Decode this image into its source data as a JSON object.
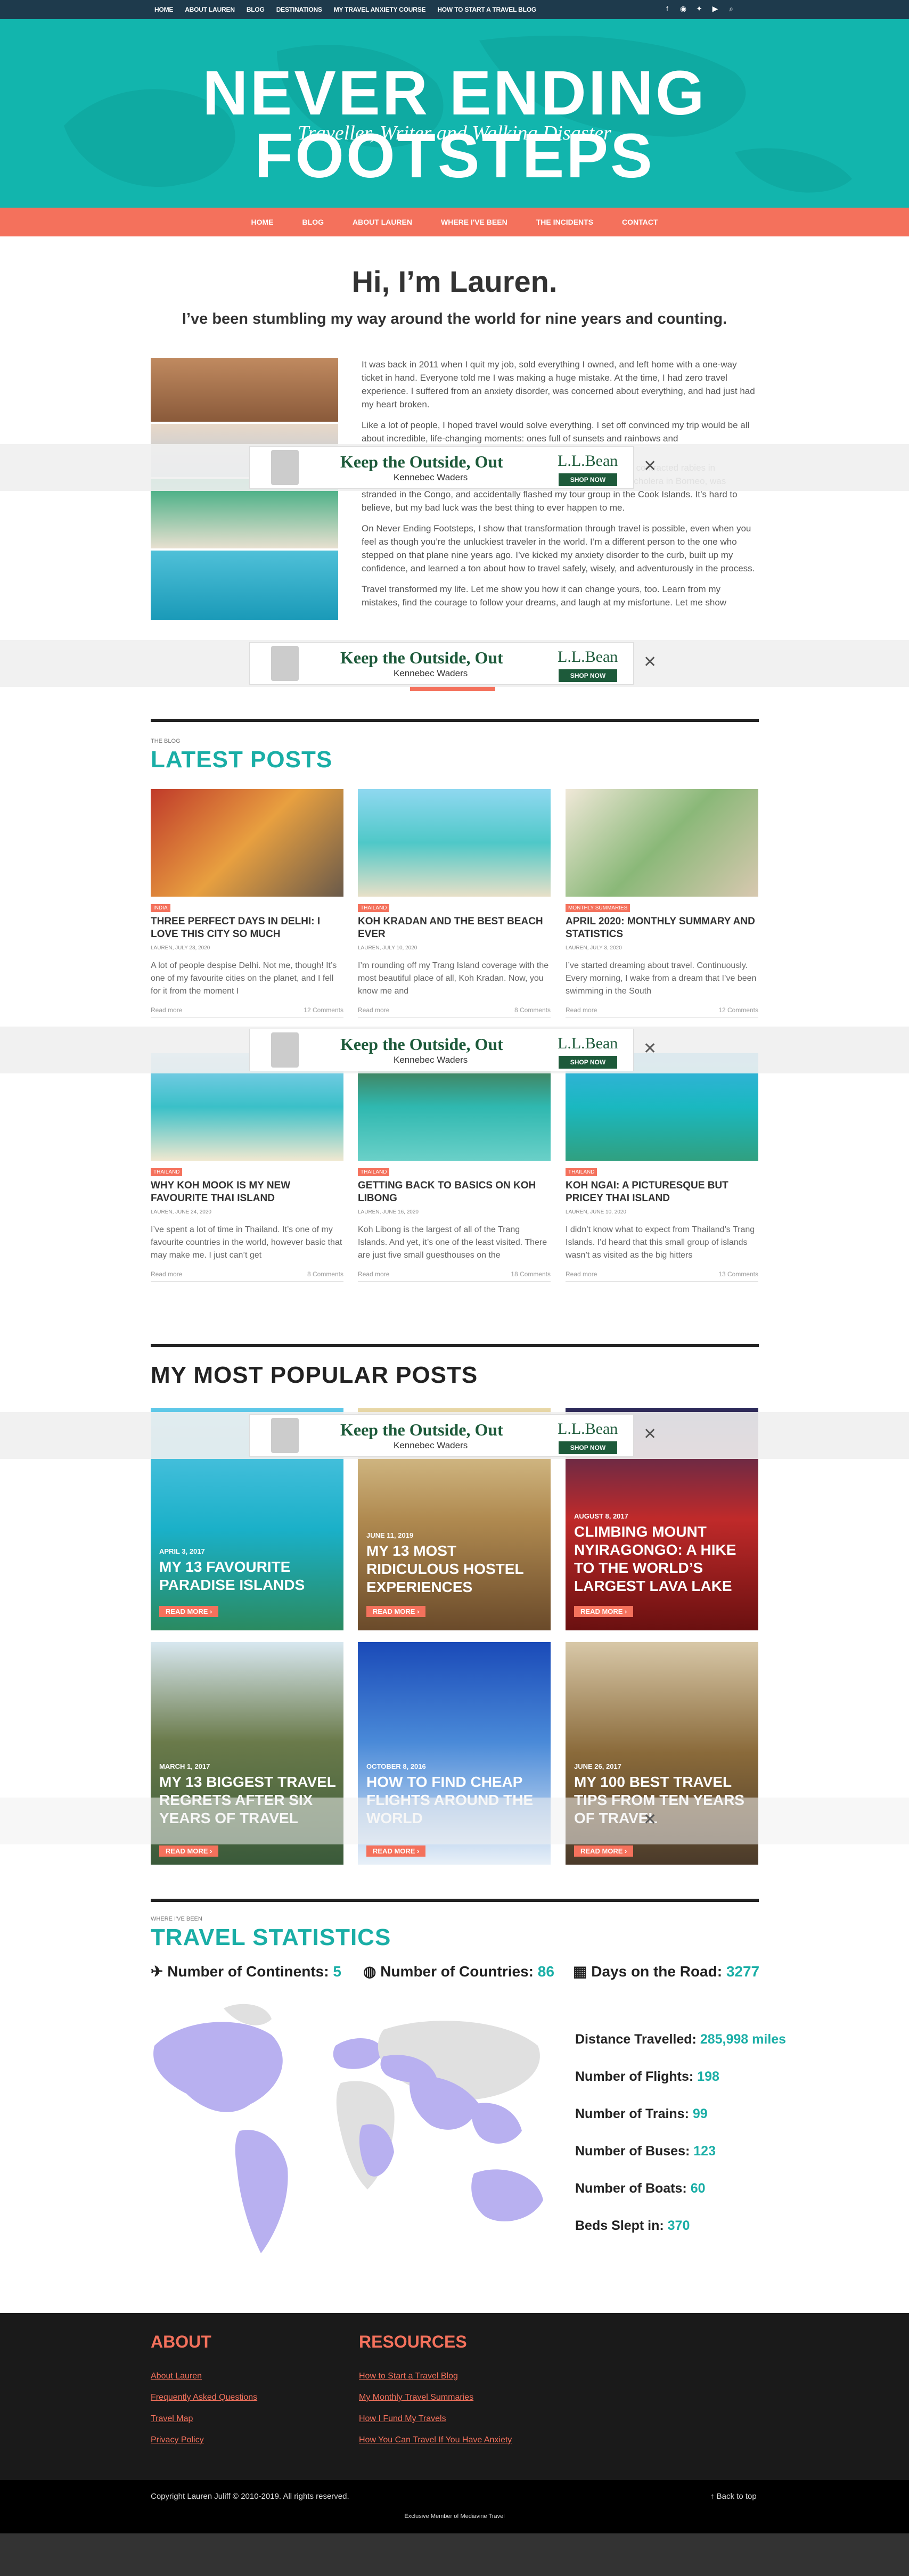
{
  "topbar": {
    "links": [
      "HOME",
      "ABOUT LAUREN",
      "BLOG",
      "DESTINATIONS",
      "MY TRAVEL ANXIETY COURSE",
      "HOW TO START A TRAVEL BLOG"
    ],
    "icons": [
      "facebook-icon",
      "rss-icon",
      "twitter-icon",
      "youtube-icon",
      "search-icon"
    ]
  },
  "hero": {
    "title": "NEVER ENDING FOOTSTEPS",
    "tagline": "Traveller, Writer and Walking Disaster"
  },
  "nav": [
    "HOME",
    "BLOG",
    "ABOUT LAUREN",
    "WHERE I'VE BEEN",
    "THE INCIDENTS",
    "CONTACT"
  ],
  "intro": {
    "heading": "Hi, I’m Lauren.",
    "subheading": "I’ve been stumbling my way around the world for nine years and counting.",
    "paragraphs": [
      "It was back in 2011 when I quit my job, sold everything I owned, and left home with a one-way ticket in hand. Everyone told me I was making a huge mistake. At the time, I had zero travel experience. I suffered from an anxiety disorder, was concerned about everything, and had just had my heart broken.",
      "Like a lot of people, I hoped travel would solve everything. I set off convinced my trip would be all about incredible, life-changing moments: ones full of sunsets and rainbows and",
      "was pickpocketed in Barcelona, run over by a motorbike in Vietnam, contracted rabies in Indonesia, and accidentally eaten a cockroach in Laos. I contracted cholera in Borneo, was stranded in the Congo, and accidentally flashed my tour group in the Cook Islands. It’s hard to believe, but my bad luck was the best thing to ever happen to me.",
      "On Never Ending Footsteps, I show that transformation through travel is possible, even when you feel as though you’re the unluckiest traveler in the world. I’m a different person to the one who stepped on that plane nine years ago. I’ve kicked my anxiety disorder to the curb, built up my confidence, and learned a ton about how to travel safely, wisely, and adventurously in the process.",
      "Travel transformed my life. Let me show you how it can change yours, too. Learn from my mistakes, find the courage to follow your dreams, and laugh at my misfortune. Let me show"
    ]
  },
  "ad": {
    "headline": "Keep the Outside, Out",
    "subline": "Kennebec Waders",
    "brand": "L.L.Bean",
    "cta": "SHOP NOW",
    "close": "✕"
  },
  "latest": {
    "eyebrow": "THE BLOG",
    "heading": "LATEST POSTS",
    "posts": [
      {
        "cat": "INDIA",
        "title": "THREE PERFECT DAYS IN DELHI: I LOVE THIS CITY SO MUCH",
        "meta": "LAUREN, JULY 23, 2020",
        "excerpt": "A lot of people despise Delhi. Not me, though! It’s one of my favourite cities on the planet, and I fell for it from the moment I",
        "more": "Read more",
        "comments": "12 Comments"
      },
      {
        "cat": "THAILAND",
        "title": "KOH KRADAN AND THE BEST BEACH EVER",
        "meta": "LAUREN, JULY 10, 2020",
        "excerpt": "I’m rounding off my Trang Island coverage with the most beautiful place of all, Koh Kradan. Now, you know me and",
        "more": "Read more",
        "comments": "8 Comments"
      },
      {
        "cat": "MONTHLY SUMMARIES",
        "title": "APRIL 2020: MONTHLY SUMMARY AND STATISTICS",
        "meta": "LAUREN, JULY 3, 2020",
        "excerpt": "I’ve started dreaming about travel. Continuously. Every morning, I wake from a dream that I’ve been swimming in the South",
        "more": "Read more",
        "comments": "12 Comments"
      },
      {
        "cat": "THAILAND",
        "title": "WHY KOH MOOK IS MY NEW FAVOURITE THAI ISLAND",
        "meta": "LAUREN, JUNE 24, 2020",
        "excerpt": "I’ve spent a lot of time in Thailand. It’s one of my favourite countries in the world, however basic that may make me. I just can’t get",
        "more": "Read more",
        "comments": "8 Comments"
      },
      {
        "cat": "THAILAND",
        "title": "GETTING BACK TO BASICS ON KOH LIBONG",
        "meta": "LAUREN, JUNE 16, 2020",
        "excerpt": "Koh Libong is the largest of all of the Trang Islands. And yet, it’s one of the least visited. There are just five small guesthouses on the",
        "more": "Read more",
        "comments": "18 Comments"
      },
      {
        "cat": "THAILAND",
        "title": "KOH NGAI: A PICTURESQUE BUT PRICEY THAI ISLAND",
        "meta": "LAUREN, JUNE 10, 2020",
        "excerpt": "I didn’t know what to expect from Thailand’s Trang Islands. I’d heard that this small group of islands wasn’t as visited as the big hitters",
        "more": "Read more",
        "comments": "13 Comments"
      }
    ]
  },
  "popular": {
    "heading": "MY MOST POPULAR POSTS",
    "more": "READ MORE",
    "posts": [
      {
        "date": "APRIL 3, 2017",
        "title": "MY 13 FAVOURITE PARADISE ISLANDS"
      },
      {
        "date": "JUNE 11, 2019",
        "title": "MY 13 MOST RIDICULOUS HOSTEL EXPERIENCES"
      },
      {
        "date": "AUGUST 8, 2017",
        "title": "CLIMBING MOUNT NYIRAGONGO: A HIKE TO THE WORLD’S LARGEST LAVA LAKE"
      },
      {
        "date": "MARCH 1, 2017",
        "title": "MY 13 BIGGEST TRAVEL REGRETS AFTER SIX YEARS OF TRAVEL"
      },
      {
        "date": "OCTOBER 8, 2016",
        "title": "HOW TO FIND CHEAP FLIGHTS AROUND THE WORLD"
      },
      {
        "date": "JUNE 26, 2017",
        "title": "MY 100 BEST TRAVEL TIPS FROM TEN YEARS OF TRAVEL"
      }
    ]
  },
  "stats": {
    "eyebrow": "WHERE I'VE BEEN",
    "heading": "TRAVEL STATISTICS",
    "top": [
      {
        "icon": "plane-icon",
        "glyph": "✈",
        "label": "Number of Continents:",
        "value": "5"
      },
      {
        "icon": "globe-icon",
        "glyph": "◍",
        "label": "Number of Countries:",
        "value": "86"
      },
      {
        "icon": "calendar-icon",
        "glyph": "▦",
        "label": "Days on the Road:",
        "value": "3277"
      }
    ],
    "right": [
      {
        "label": "Distance Travelled:",
        "value": "285,998 miles"
      },
      {
        "label": "Number of Flights:",
        "value": "198"
      },
      {
        "label": "Number of Trains:",
        "value": "99"
      },
      {
        "label": "Number of Buses:",
        "value": "123"
      },
      {
        "label": "Number of Boats:",
        "value": "60"
      },
      {
        "label": "Beds Slept in:",
        "value": "370"
      }
    ]
  },
  "footer": {
    "about_heading": "ABOUT",
    "about_links": [
      "About Lauren",
      "Frequently Asked Questions",
      "Travel Map",
      "Privacy Policy"
    ],
    "res_heading": "RESOURCES",
    "res_links": [
      "How to Start a Travel Blog",
      "My Monthly Travel Summaries",
      "How I Fund My Travels",
      "How You Can Travel If You Have Anxiety"
    ]
  },
  "copyright": {
    "text": "Copyright Lauren Juliff © 2010-2019. All rights reserved.",
    "back": "↑ Back to top",
    "member": "Exclusive Member of Mediavine Travel"
  },
  "colors": {
    "teal": "#12b5ad",
    "coral": "#f4715c",
    "navy": "#1e3a4c"
  }
}
